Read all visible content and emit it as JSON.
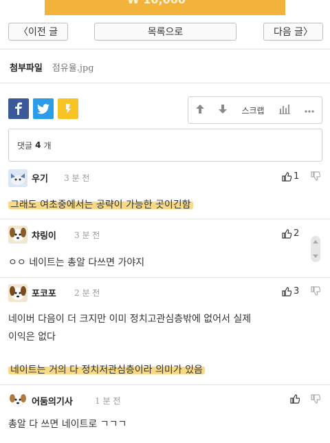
{
  "banner": {
    "text": "₩ 10,000"
  },
  "nav": {
    "prev": "이전 글",
    "list": "목록으로",
    "next": "다음 글"
  },
  "attachment": {
    "label": "첨부파일",
    "filename": "점유율.jpg"
  },
  "toolbar": {
    "scrap": "스크랩"
  },
  "comment_box": {
    "label": "댓글",
    "count": "4",
    "unit": "개"
  },
  "comments": [
    {
      "nick": "우기",
      "time": "3 분 전",
      "likes": "1",
      "text": "그래도 여초중에서는 공략이 가능한 곳이긴함"
    },
    {
      "nick": "챠링이",
      "time": "3 분 전",
      "likes": "2",
      "text": "ㅇㅇ 네이트는 총알 다쓰면 가야지"
    },
    {
      "nick": "포코포",
      "time": "2 분 전",
      "likes": "3",
      "text_line1": "네이버 다음이 더 크지만 이미 정치고관심층밖에 없어서 실제",
      "text_line2": "이익은 없다",
      "text_line3": "네이트는 거의 다 정치저관심층이라 의미가 있음"
    },
    {
      "nick": "어둠의기사",
      "time": "1 분 전",
      "likes": "",
      "text": "총알 다 쓰면 네이트로 ㄱㄱㄱ"
    }
  ],
  "colors": {
    "facebook": "#3b5998",
    "twitter": "#2b9de8",
    "kakaostory": "#f7c325",
    "highlight": "#f6ce5c"
  }
}
